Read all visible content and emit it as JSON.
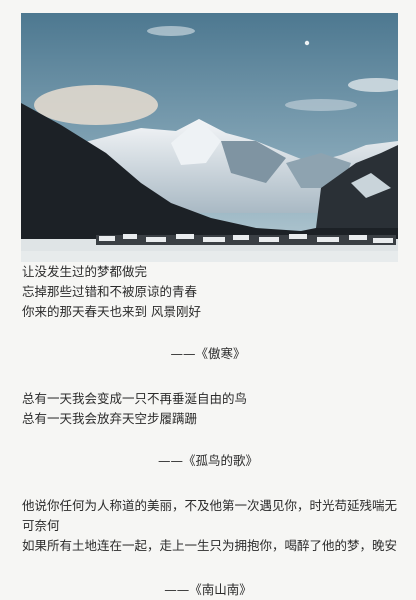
{
  "stanzas": [
    {
      "lines": [
        "让没发生过的梦都做完",
        "忘掉那些过错和不被原谅的青春",
        "你来的那天春天也来到  风景刚好"
      ],
      "attribution": "——《傲寒》"
    },
    {
      "lines": [
        "总有一天我会变成一只不再垂涎自由的鸟",
        "总有一天我会放弃天空步履蹒跚"
      ],
      "attribution": "——《孤鸟的歌》"
    },
    {
      "lines": [
        "他说你任何为人称道的美丽，不及他第一次遇见你，时光苟延残喘无可奈何",
        "如果所有土地连在一起，走上一生只为拥抱你，喝醉了他的梦，晚安"
      ],
      "attribution": "——《南山南》"
    }
  ],
  "photo": {
    "icon": "snowy-mountain-village-photo"
  }
}
